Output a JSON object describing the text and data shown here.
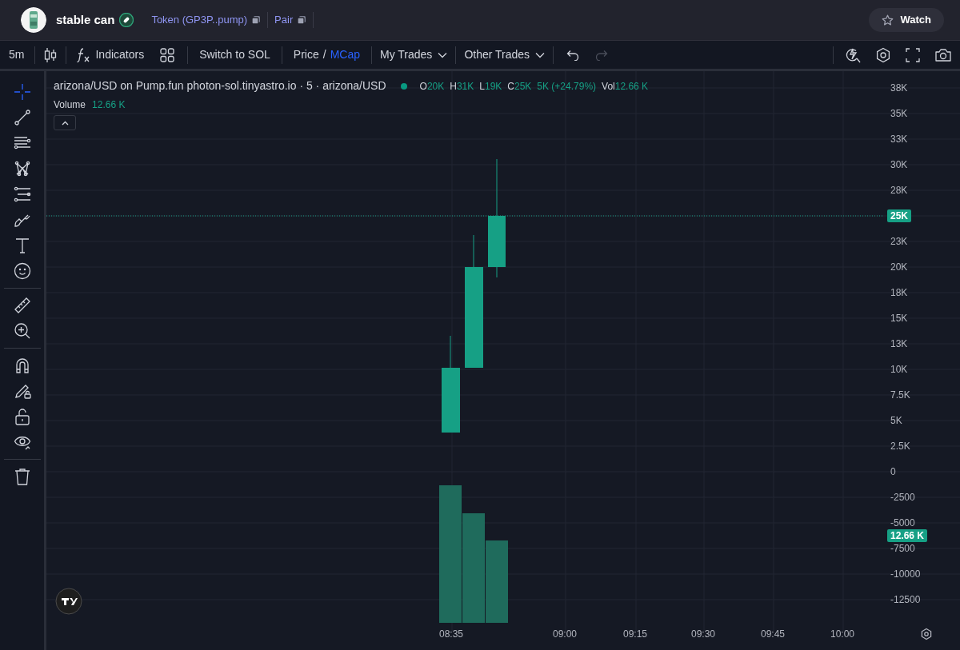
{
  "header": {
    "token_name": "stable can",
    "token_link": "Token (GP3P..pump)",
    "pair_link": "Pair",
    "watch_button": "Watch"
  },
  "toolbar": {
    "interval": "5m",
    "indicators": "Indicators",
    "switch_button": "Switch to SOL",
    "price_modes": [
      {
        "label": "Price",
        "selected": false
      },
      {
        "label": "MCap",
        "selected": true
      }
    ],
    "separator": "/",
    "my_trades": "My Trades",
    "other_trades": "Other Trades"
  },
  "drawing_tools": [
    {
      "kind": "crosshair",
      "selected": true
    },
    {
      "kind": "trendline",
      "selected": false
    },
    {
      "kind": "lines",
      "selected": false
    },
    {
      "kind": "pattern",
      "selected": false
    },
    {
      "kind": "fib",
      "selected": false
    },
    {
      "kind": "brush",
      "selected": false
    },
    {
      "kind": "text",
      "selected": false
    },
    {
      "kind": "emoji",
      "selected": false
    },
    {
      "kind": "divider"
    },
    {
      "kind": "ruler",
      "selected": false
    },
    {
      "kind": "zoom",
      "selected": false
    },
    {
      "kind": "divider"
    },
    {
      "kind": "magnet",
      "selected": false
    },
    {
      "kind": "lockdraw",
      "selected": false
    },
    {
      "kind": "lock",
      "selected": false
    },
    {
      "kind": "eye",
      "selected": false
    },
    {
      "kind": "divider"
    },
    {
      "kind": "trash",
      "selected": false
    }
  ],
  "legend": {
    "title": "arizona/USD on Pump.fun photon-sol.tinyastro.io · 5 · arizona/USD",
    "status_dot": {
      "color": "#089981"
    },
    "ohlc": [
      {
        "label": "O",
        "value": "20K"
      },
      {
        "label": "H",
        "value": "31K"
      },
      {
        "label": "L",
        "value": "19K"
      },
      {
        "label": "C",
        "value": "25K"
      }
    ],
    "change": "5K (+24.79%)",
    "vol_label": "Vol",
    "vol_value": "12.66 K",
    "volume_label": "Volume",
    "volume_value": "12.66 K"
  },
  "price_axis": [
    {
      "label": "38K",
      "kind": "tick"
    },
    {
      "label": "35K",
      "kind": "tick"
    },
    {
      "label": "33K",
      "kind": "tick"
    },
    {
      "label": "30K",
      "kind": "tick"
    },
    {
      "label": "28K",
      "kind": "tick"
    },
    {
      "label": "25K",
      "kind": "last_price"
    },
    {
      "label": "23K",
      "kind": "tick"
    },
    {
      "label": "20K",
      "kind": "tick"
    },
    {
      "label": "18K",
      "kind": "tick"
    },
    {
      "label": "15K",
      "kind": "tick"
    },
    {
      "label": "13K",
      "kind": "tick"
    },
    {
      "label": "10K",
      "kind": "tick"
    },
    {
      "label": "7.5K",
      "kind": "tick"
    },
    {
      "label": "5K",
      "kind": "tick"
    },
    {
      "label": "2.5K",
      "kind": "tick"
    },
    {
      "label": "0",
      "kind": "tick"
    },
    {
      "label": "-2500",
      "kind": "tick"
    },
    {
      "label": "-5000",
      "kind": "tick"
    },
    {
      "label": "-7500",
      "kind": "tick"
    },
    {
      "label": "-10000",
      "kind": "tick"
    },
    {
      "label": "-12500",
      "kind": "tick"
    }
  ],
  "volume_badge": "12.66 K",
  "time_axis": [
    "08:35",
    "09:00",
    "09:15",
    "09:30",
    "09:45",
    "10:00"
  ]
}
